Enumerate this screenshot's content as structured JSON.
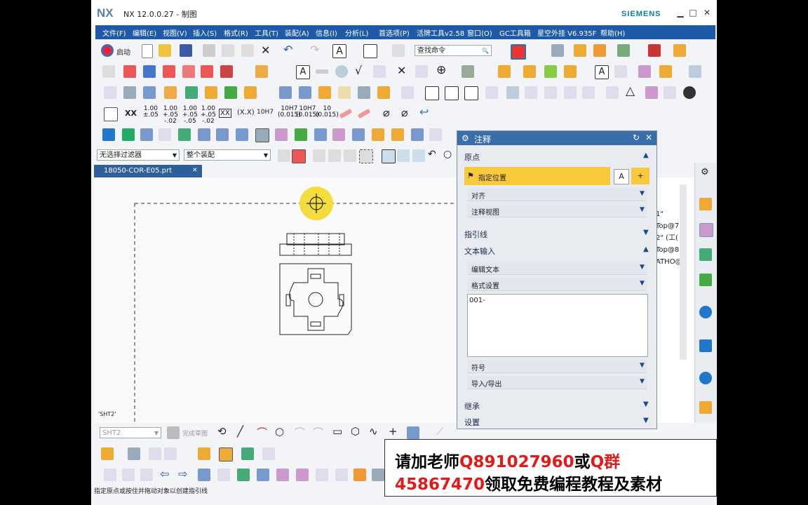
{
  "window": {
    "logo": "NX",
    "title": "NX 12.0.0.27 - 制图",
    "brand": "SIEMENS",
    "min": "▁",
    "max": "□",
    "close": "✕"
  },
  "menu": [
    "文件(F)",
    "编辑(E)",
    "视图(V)",
    "插入(S)",
    "格式(R)",
    "工具(T)",
    "装配(A)",
    "信息(I)",
    "分析(L)",
    "首选项(P)",
    "活牌工具v2.58",
    "窗口(O)",
    "GC工具箱",
    "星空外挂 V6.935F",
    "帮助(H)"
  ],
  "toolbar1": {
    "start_label": "启动",
    "search_placeholder": "查找命令"
  },
  "toolbar4": {
    "tol1": "1.00\n±.05",
    "tol2": "1.00\n+.05\n-.02",
    "tol3": "1.00\n+.05\n-.05",
    "tol4": "1.00\n+.05\n-.02",
    "xx": "XX",
    "xxb": "XX",
    "xxp": "(X.X)",
    "h7": "10H7",
    "h7a": "10H7\n(0.015)",
    "h7b": "10H7\n(0.015)",
    "h7c": "10\n(0.015)"
  },
  "filter": {
    "selection": "无选择过滤器",
    "assembly": "整个装配"
  },
  "tab": {
    "label": "18050-COR-E05.prt",
    "close": "✕"
  },
  "canvas": {
    "sheet_label": "'SHT2'"
  },
  "resource_list": [
    "1\"",
    "Top@7",
    "2\" (工(",
    "Top@8",
    "ATHO@"
  ],
  "dialog": {
    "title": "注释",
    "origin": "原点",
    "specify_location": "指定位置",
    "align": "对齐",
    "annotation_view": "注释视图",
    "leader": "指引线",
    "text_input": "文本输入",
    "edit_text": "编辑文本",
    "format_settings": "格式设置",
    "text_value": "001-",
    "symbol": "符号",
    "import_export": "导入/导出",
    "inherit": "继承",
    "settings": "设置"
  },
  "bottom": {
    "sheet_combo": "SHT2",
    "finish_sketch": "完成草图"
  },
  "status": "指定原点或按住并拖动对象以创建指引线",
  "banner": {
    "line1_a": "请加老师",
    "line1_b": "Q891027960",
    "line1_c": "或",
    "line1_d": "Q群",
    "line2_a": "45867470",
    "line2_b": "领取免费编程教程及素材"
  },
  "colors": {
    "menubar": "#1f5aa8",
    "dialog_header": "#3a6eaa",
    "highlight": "#f7c93b",
    "banner_red": "#e21a1a"
  }
}
